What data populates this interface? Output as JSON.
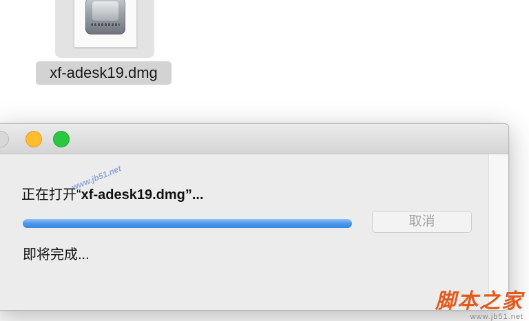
{
  "desktop": {
    "file_icon": "disk-image-icon",
    "file_name": "xf-adesk19.dmg"
  },
  "dialog": {
    "title_buttons": [
      "close",
      "minimize",
      "zoom"
    ],
    "message_prefix": "正在打开“",
    "message_name": "xf-adesk19.dmg",
    "message_suffix": "”...",
    "progress_percent": 100,
    "cancel_label": "取消",
    "status": "即将完成..."
  },
  "watermark": {
    "diagonal": "www.jb51.net",
    "brand": "脚本之家",
    "url": "www.jb51.net"
  },
  "colors": {
    "progress": "#4b97ec",
    "minimize": "#febc2e",
    "zoom": "#2ac840",
    "brand": "#e25a1c"
  }
}
